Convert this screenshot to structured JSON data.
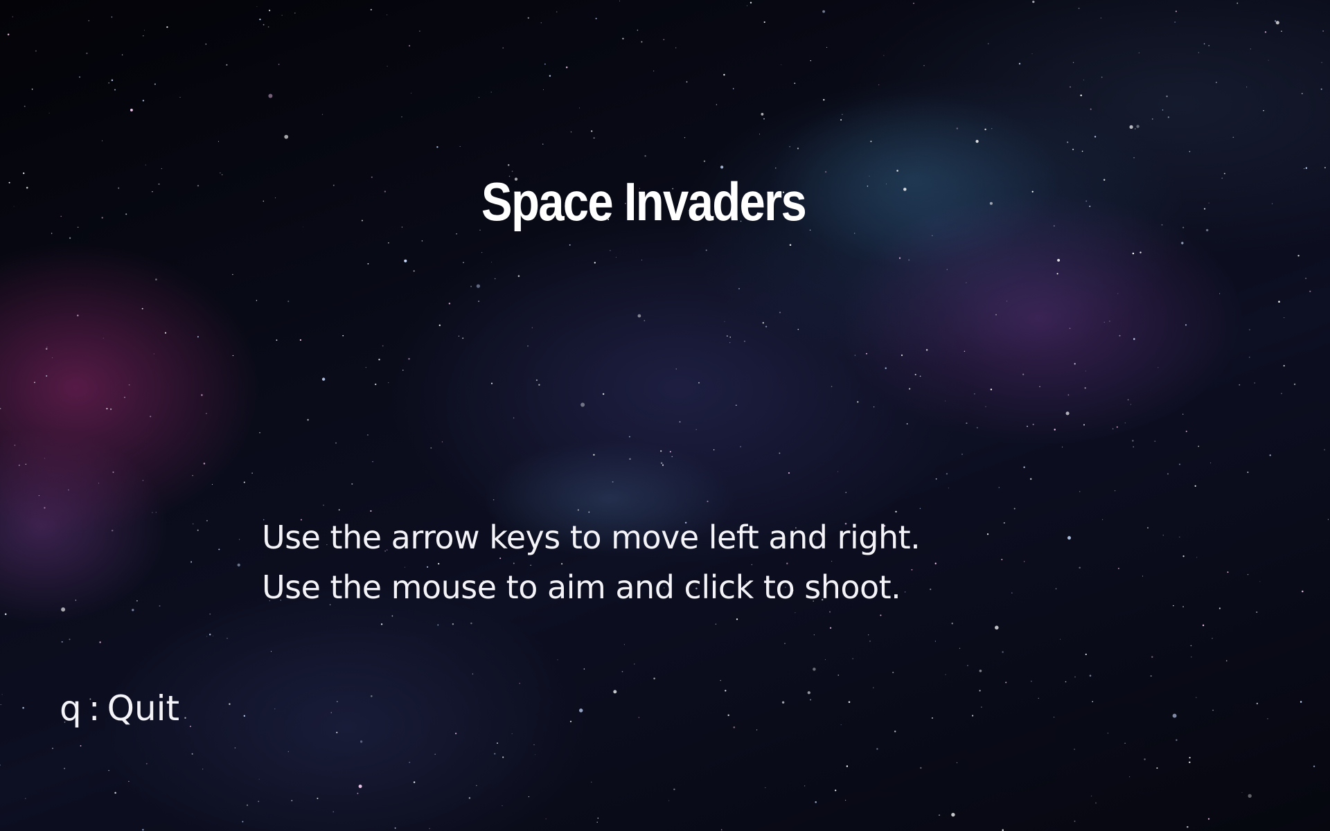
{
  "game": {
    "title": "Space Invaders",
    "instructions": [
      "Use the arrow keys to move left and right.",
      "Use the mouse to aim and click to shoot."
    ],
    "quit_key": "q",
    "quit_separator": ":",
    "quit_label": "Quit"
  },
  "colors": {
    "text": "#ffffff",
    "background": "#05060c"
  }
}
